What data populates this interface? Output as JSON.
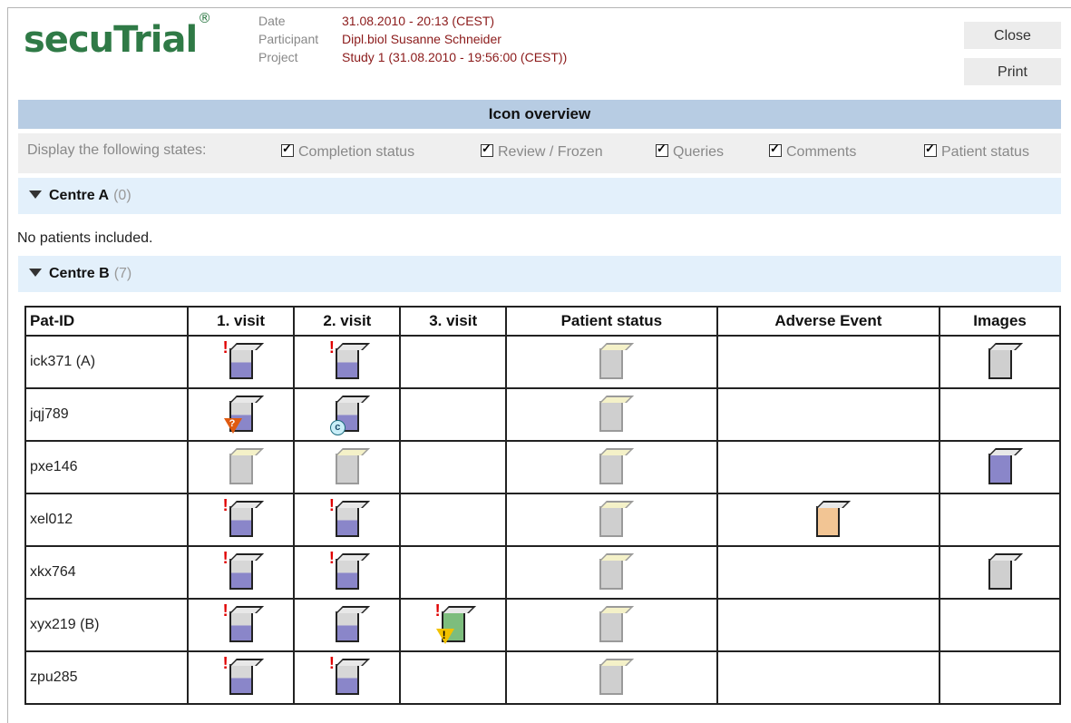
{
  "app": {
    "logo": "secuTrial",
    "logo_mark": "®"
  },
  "header": {
    "date_label": "Date",
    "date_value": "31.08.2010 - 20:13 (CEST)",
    "participant_label": "Participant",
    "participant_value": "Dipl.biol Susanne Schneider",
    "project_label": "Project",
    "project_value": "Study 1 (31.08.2010 - 19:56:00 (CEST))"
  },
  "buttons": {
    "close": "Close",
    "print": "Print"
  },
  "title": "Icon overview",
  "filters": {
    "label": "Display the following states:",
    "options": [
      {
        "label": "Completion status",
        "checked": true
      },
      {
        "label": "Review / Frozen",
        "checked": true
      },
      {
        "label": "Queries",
        "checked": true
      },
      {
        "label": "Comments",
        "checked": true
      },
      {
        "label": "Patient status",
        "checked": true
      }
    ]
  },
  "centres": [
    {
      "name": "Centre A",
      "count": "(0)",
      "empty_text": "No patients included."
    },
    {
      "name": "Centre B",
      "count": "(7)"
    }
  ],
  "table": {
    "headers": [
      "Pat-ID",
      "1. visit",
      "2. visit",
      "3. visit",
      "Patient status",
      "Adverse Event",
      "Images"
    ],
    "rows": [
      {
        "id": "ick371 (A)",
        "cells": [
          "partial-alert",
          "partial-alert",
          "",
          "gray",
          "",
          "gray-box"
        ]
      },
      {
        "id": "jqj789",
        "cells": [
          "partial-query",
          "partial-comment",
          "",
          "gray",
          "",
          ""
        ]
      },
      {
        "id": "pxe146",
        "cells": [
          "gray",
          "gray",
          "",
          "gray",
          "",
          "full"
        ]
      },
      {
        "id": "xel012",
        "cells": [
          "partial-alert",
          "partial-alert",
          "",
          "gray",
          "orange",
          ""
        ]
      },
      {
        "id": "xkx764",
        "cells": [
          "partial-alert",
          "partial-alert",
          "",
          "gray",
          "",
          "gray-box"
        ]
      },
      {
        "id": "xyx219 (B)",
        "cells": [
          "partial-alert",
          "partial",
          "green-alert-warning",
          "gray",
          "",
          ""
        ]
      },
      {
        "id": "zpu285",
        "cells": [
          "partial-alert",
          "partial-alert",
          "",
          "gray",
          "",
          ""
        ]
      }
    ]
  }
}
